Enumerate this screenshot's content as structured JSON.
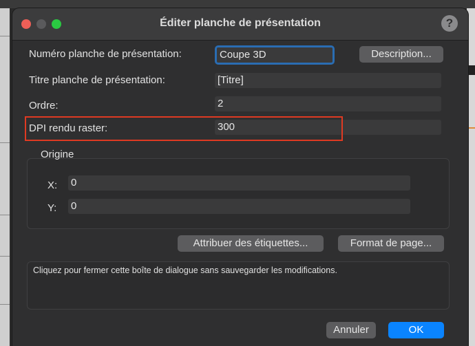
{
  "dialog": {
    "title": "Éditer planche de présentation",
    "help_label": "?"
  },
  "form": {
    "numero": {
      "label": "Numéro planche de présentation:",
      "value": "Coupe 3D"
    },
    "description_button": "Description...",
    "titre": {
      "label": "Titre planche de présentation:",
      "value": "[Titre]"
    },
    "ordre": {
      "label": "Ordre:",
      "value": "2"
    },
    "dpi": {
      "label": "DPI rendu raster:",
      "value": "300"
    }
  },
  "origine": {
    "title": "Origine",
    "x": {
      "label": "X:",
      "value": "0"
    },
    "y": {
      "label": "Y:",
      "value": "0"
    }
  },
  "buttons": {
    "attribuer": "Attribuer des étiquettes...",
    "format": "Format de page...",
    "annuler": "Annuler",
    "ok": "OK"
  },
  "message": "Cliquez pour fermer cette boîte de dialogue sans sauvegarder les modifications.",
  "colors": {
    "accent": "#0a84ff",
    "focus_ring": "#2a6db3",
    "highlight_box": "#e03a22"
  }
}
